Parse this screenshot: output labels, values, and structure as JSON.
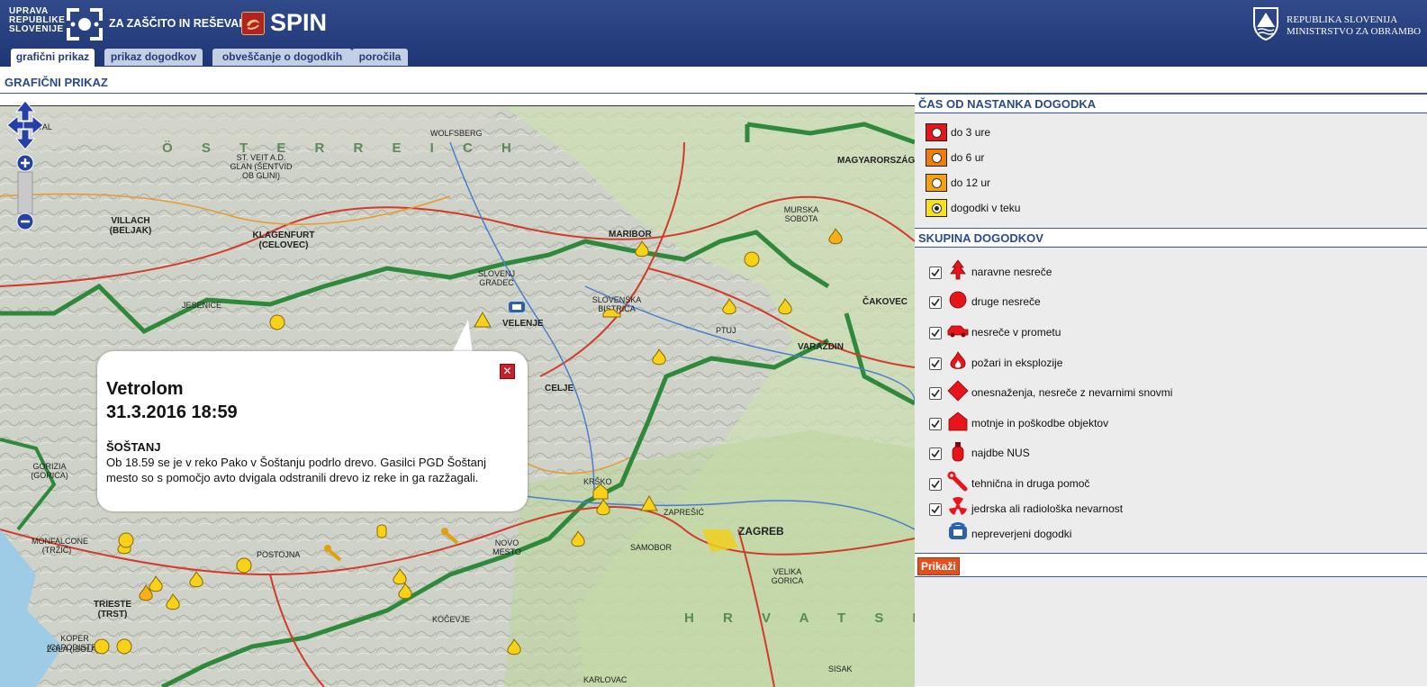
{
  "header": {
    "logo_lines": [
      "UPRAVA",
      "REPUBLIKE",
      "SLOVENIJE"
    ],
    "logo_subtitle": "ZA ZAŠČITO IN REŠEVANJE",
    "app_name": "SPIN",
    "gov_line1": "REPUBLIKA SLOVENIJA",
    "gov_line2": "MINISTRSTVO ZA OBRAMBO"
  },
  "tabs": [
    {
      "label": "grafični prikaz",
      "active": true
    },
    {
      "label": "prikaz dogodkov",
      "active": false
    },
    {
      "label": "obveščanje o dogodkih",
      "active": false
    },
    {
      "label": "poročila",
      "active": false
    }
  ],
  "page_title": "GRAFIČNI PRIKAZ",
  "map": {
    "country_labels": [
      "Ö S T E R R E I C H",
      "H R V A T S K A",
      "MAGYARORSZÁG"
    ],
    "cities": [
      "KLAGENFURT (CELOVEC)",
      "VILLACH (BELJAK)",
      "MARIBOR",
      "VELENJE",
      "CELJE",
      "ZAGREB",
      "TRIESTE (TRST)",
      "JESENICE",
      "KRŠKO",
      "ZAPREŠIĆ",
      "SAMOBOR",
      "ČAKOVEC",
      "VARAŽDIN",
      "MURSKA SOBOTA",
      "PTUJ",
      "KOČEVJE",
      "POSTOJNA",
      "NOVO MESTO",
      "KARLOVAC",
      "KOPER (CAPODISTRIA)",
      "ST. VEIT A.D. GLAN (ŠENTVID OB GLINI)",
      "SPITTAL",
      "WOLFSBERG",
      "SLOVENJ GRADEC",
      "SLOVENSKA BISTRICA",
      "MONFALCONE (TRŽIČ)",
      "GORIZIA (GORICA)",
      "VELIKA GORICA",
      "ZOLA (ISOLA)",
      "SISAK"
    ]
  },
  "popup": {
    "title": "Vetrolom",
    "datetime": "31.3.2016 18:59",
    "place": "ŠOŠTANJ",
    "body": "Ob 18.59 se je v reko Pako v Šoštanju podrlo drevo. Gasilci PGD Šoštanj mesto so s pomočjo avto dvigala odstranili drevo iz reke in ga razžagali.",
    "close_symbol": "✕"
  },
  "legend": {
    "time_title": "ČAS OD NASTANKA DOGODKA",
    "time_items": [
      {
        "label": "do 3 ure",
        "color": "#e8141b"
      },
      {
        "label": "do 6 ur",
        "color": "#f07d0a"
      },
      {
        "label": "do 12 ur",
        "color": "#f5a30c"
      },
      {
        "label": "dogodki v teku",
        "color": "#f8e21a"
      }
    ],
    "group_title": "SKUPINA DOGODKOV",
    "group_items": [
      {
        "label": "naravne nesreče",
        "icon": "tree-icon",
        "checked": true
      },
      {
        "label": "druge nesreče",
        "icon": "circle-icon",
        "checked": true
      },
      {
        "label": "nesreče v prometu",
        "icon": "car-icon",
        "checked": true
      },
      {
        "label": "požari in eksplozije",
        "icon": "fire-icon",
        "checked": true
      },
      {
        "label": "onesnaženja, nesreče z nevarnimi snovmi",
        "icon": "hazard-diamond-icon",
        "checked": true
      },
      {
        "label": "motnje in poškodbe objektov",
        "icon": "house-icon",
        "checked": true
      },
      {
        "label": "najdbe NUS",
        "icon": "grenade-icon",
        "checked": true
      },
      {
        "label": "tehnična in druga pomoč",
        "icon": "wrench-icon",
        "checked": true
      },
      {
        "label": "jedrska ali radiološka nevarnost",
        "icon": "radiation-icon",
        "checked": true
      },
      {
        "label": "nepreverjeni dogodki",
        "icon": "phone-icon",
        "checked": false
      }
    ],
    "show_button": "Prikaži"
  },
  "colors": {
    "header_blue": "#233c78",
    "accent_red": "#e8141b",
    "marker_yellow": "#f8d21a"
  }
}
